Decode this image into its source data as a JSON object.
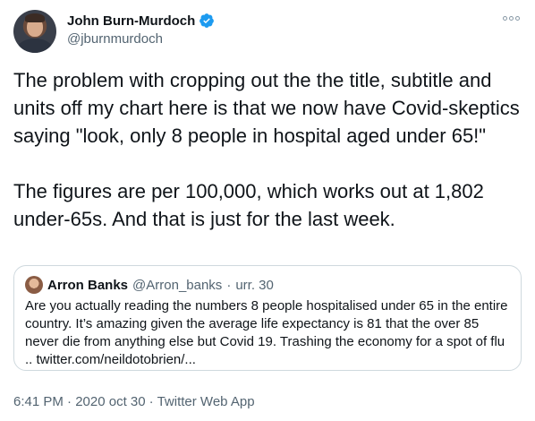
{
  "author": {
    "display_name": "John Burn-Murdoch",
    "handle": "@jburnmurdoch",
    "verified": true
  },
  "body": {
    "text": "The problem with cropping out the the title, subtitle and units off my chart here is that we now have Covid-skeptics saying \"look, only 8 people in hospital aged under 65!\"\n\nThe figures are per 100,000, which works out at 1,802 under-65s. And that is just for the last week."
  },
  "quote": {
    "display_name": "Arron Banks",
    "handle": "@Arron_banks",
    "separator": "·",
    "date": "urr. 30",
    "text": "Are you actually reading the numbers 8 people hospitalised under 65 in the entire country. It’s amazing given the average life expectancy is 81 that the over 85 never die from anything else but Covid 19. Trashing the economy for a spot of flu .. twitter.com/neildotobrien/..."
  },
  "footer": {
    "timestamp": "6:41 PM · 2020 oct 30",
    "separator": "·",
    "app": "Twitter Web App"
  },
  "colors": {
    "text_primary": "#0f1419",
    "text_secondary": "#536471",
    "verified_blue": "#1d9bf0",
    "border": "#cfd9de"
  }
}
